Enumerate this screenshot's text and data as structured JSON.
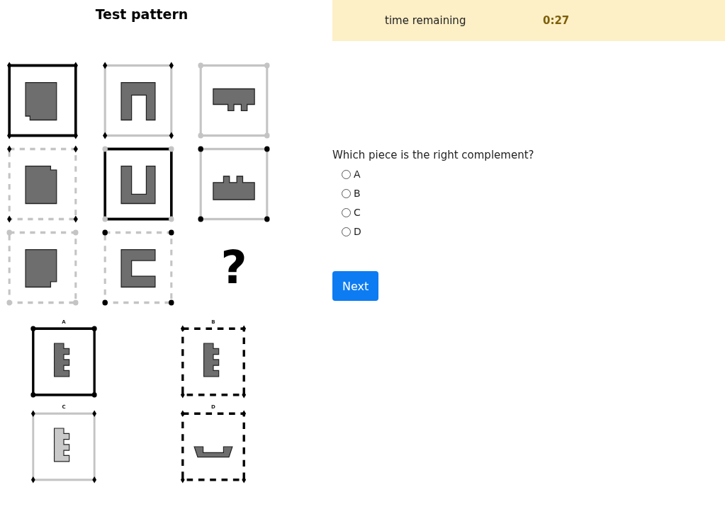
{
  "title": "Test pattern",
  "grid": [
    {
      "kind": "tile"
    },
    {
      "kind": "tile"
    },
    {
      "kind": "tile"
    },
    {
      "kind": "tile"
    },
    {
      "kind": "tile"
    },
    {
      "kind": "tile"
    },
    {
      "kind": "tile"
    },
    {
      "kind": "tile"
    },
    {
      "kind": "question",
      "text": "?"
    }
  ],
  "options": [
    {
      "label": "A"
    },
    {
      "label": "B"
    },
    {
      "label": "C"
    },
    {
      "label": "D"
    }
  ],
  "timer": {
    "label": "time remaining",
    "value": "0:27"
  },
  "question": "Which piece is the right complement?",
  "answers": [
    {
      "label": "A",
      "selected": false
    },
    {
      "label": "B",
      "selected": false
    },
    {
      "label": "C",
      "selected": false
    },
    {
      "label": "D",
      "selected": false
    }
  ],
  "next_button": "Next"
}
